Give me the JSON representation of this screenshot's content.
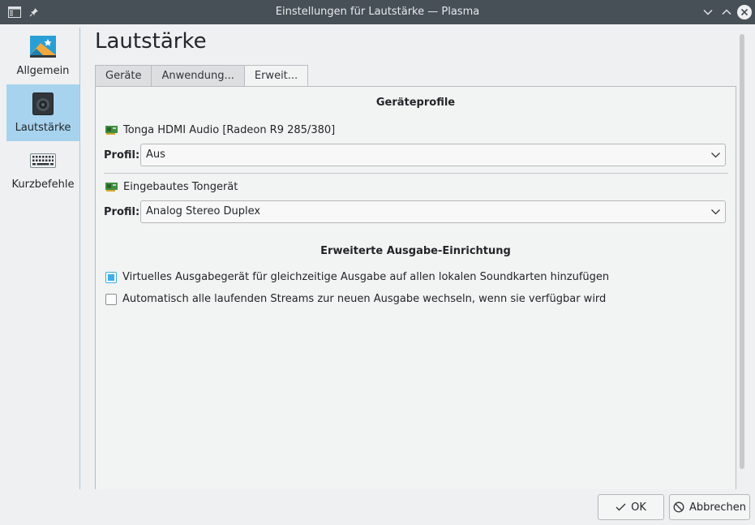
{
  "window": {
    "title": "Einstellungen für Lautstärke — Plasma"
  },
  "sidebar": {
    "items": [
      {
        "label": "Allgemein",
        "icon": "preferences-icon",
        "active": false
      },
      {
        "label": "Lautstärke",
        "icon": "speaker-icon",
        "active": true
      },
      {
        "label": "Kurzbefehle",
        "icon": "keyboard-icon",
        "active": false
      }
    ]
  },
  "page": {
    "title": "Lautstärke"
  },
  "tabs": [
    {
      "label": "Geräte",
      "active": false
    },
    {
      "label": "Anwendung...",
      "active": false
    },
    {
      "label": "Erweit...",
      "active": true
    }
  ],
  "profiles_section": {
    "title": "Geräteprofile",
    "devices": [
      {
        "name": "Tonga HDMI Audio [Radeon R9 285/380]",
        "profile_label": "Profil:",
        "profile_value": "Aus"
      },
      {
        "name": "Eingebautes Tongerät",
        "profile_label": "Profil:",
        "profile_value": "Analog Stereo Duplex"
      }
    ]
  },
  "output_section": {
    "title": "Erweiterte Ausgabe-Einrichtung",
    "options": [
      {
        "label": "Virtuelles Ausgabegerät für gleichzeitige Ausgabe auf allen lokalen Soundkarten hinzufügen",
        "checked": true
      },
      {
        "label": "Automatisch alle laufenden Streams zur neuen Ausgabe wechseln, wenn sie verfügbar wird",
        "checked": false
      }
    ]
  },
  "buttons": {
    "ok": "OK",
    "cancel": "Abbrechen"
  },
  "colors": {
    "titlebar": "#475057",
    "accent": "#3daee9",
    "selection": "#a7d3ee"
  }
}
